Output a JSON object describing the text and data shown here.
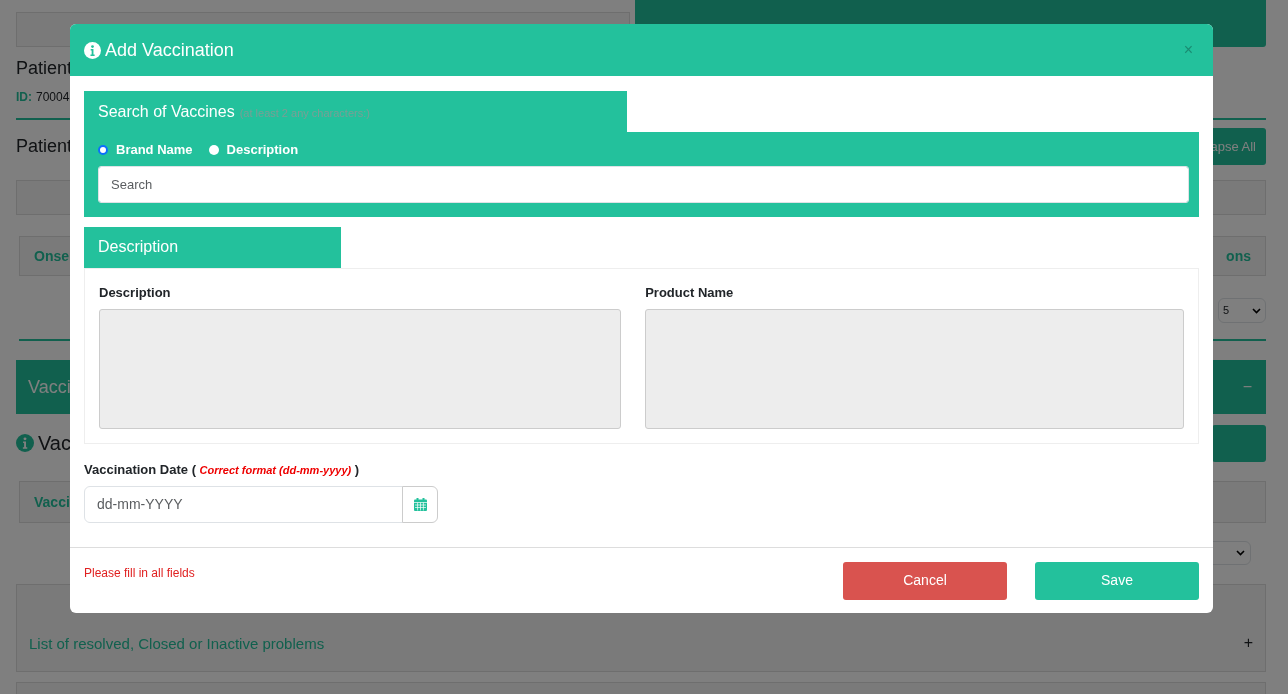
{
  "page": {
    "patient_label": "Patient",
    "id_label": "ID:",
    "id_value": "70004",
    "section_label": "Patient",
    "collapse_button": "apse All",
    "table_1": {
      "column_1": "Onse",
      "column_last": "ons"
    },
    "page_size": "5",
    "vaccination_panel": {
      "title": "Vacci",
      "toggle": "−"
    },
    "info_text": "Vac",
    "table_2": {
      "column_1": "Vacci"
    },
    "history_panel": {
      "subtitle": "List of resolved, Closed or Inactive problems",
      "toggle": "+"
    }
  },
  "modal": {
    "title": "Add Vaccination",
    "close": "×",
    "search": {
      "title": "Search of Vaccines",
      "hint": "(at least 2 any characters:)",
      "options": [
        {
          "label": "Brand Name",
          "selected": true
        },
        {
          "label": "Description",
          "selected": false
        }
      ],
      "placeholder": "Search"
    },
    "description": {
      "title": "Description",
      "fields": [
        {
          "label": "Description"
        },
        {
          "label": "Product Name"
        }
      ]
    },
    "date": {
      "label": "Vaccination Date (",
      "format_note": "Correct format (dd-mm-yyyy)",
      "label_end": ")",
      "placeholder": "dd-mm-YYYY"
    },
    "message": "Please fill in all fields",
    "buttons": [
      {
        "label": "Cancel",
        "kind": "danger"
      },
      {
        "label": "Save",
        "kind": "primary"
      }
    ]
  }
}
